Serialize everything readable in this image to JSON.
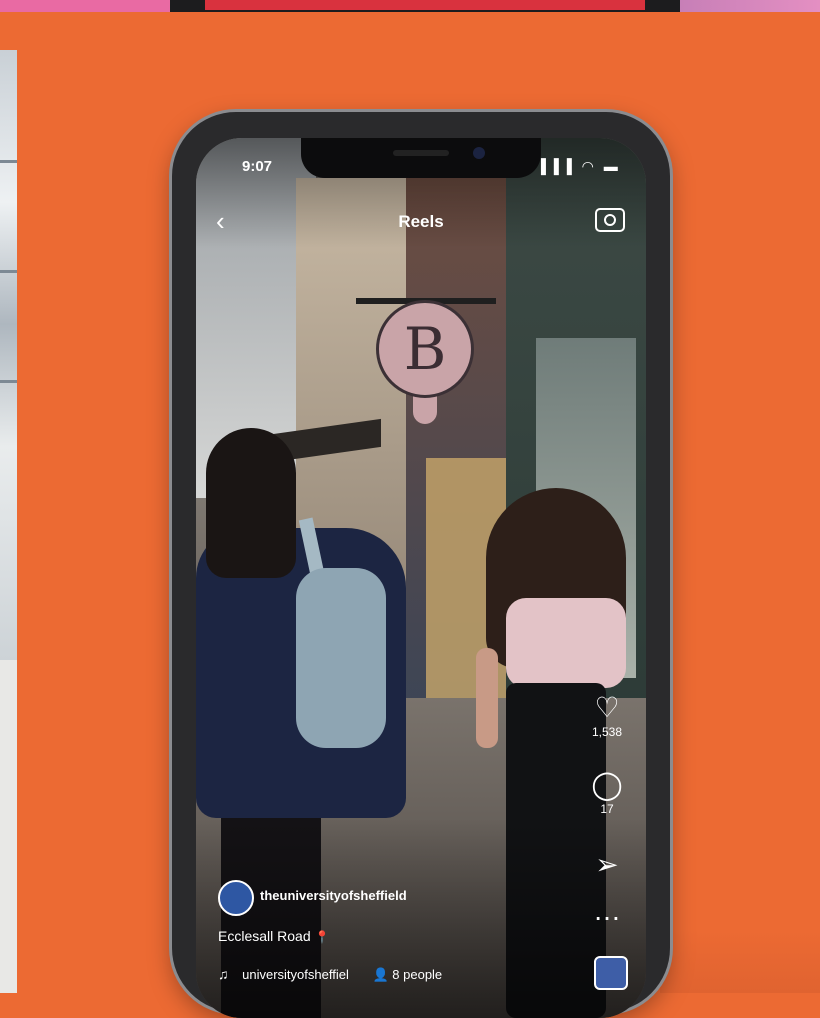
{
  "status_bar": {
    "time": "9:07",
    "signal_icons": "▐▐▐ ◠ ▬"
  },
  "header": {
    "title": "Reels",
    "back_icon": "chevron-left-icon",
    "camera_icon": "camera-icon"
  },
  "sign_letter": "B",
  "actions": {
    "likes": "1,538",
    "comments": "17",
    "like_icon": "heart-icon",
    "comment_icon": "comment-icon",
    "share_icon": "send-icon",
    "more_label": "…"
  },
  "post": {
    "account": "theuniversityofsheffield",
    "caption": "Ecclesall Road",
    "caption_emoji": "📍",
    "audio": "universityofsheffiel",
    "people": "8 people"
  },
  "colors": {
    "background": "#ec6a33",
    "accent_pink": "#e96aa3",
    "accent_red": "#d9323e"
  }
}
